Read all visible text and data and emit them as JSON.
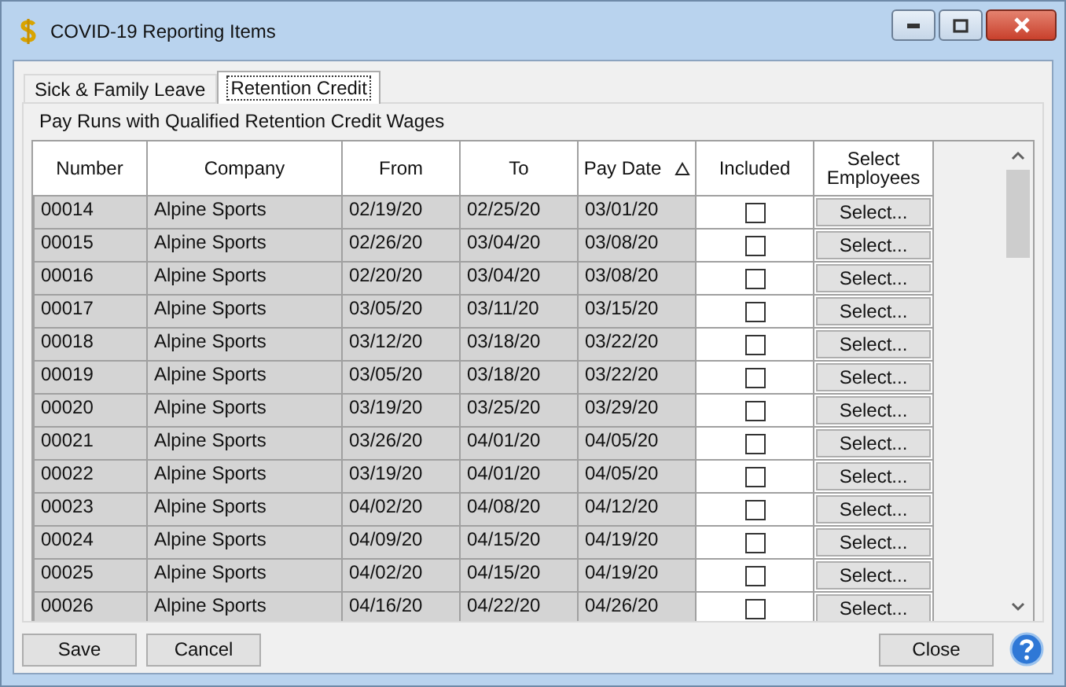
{
  "window": {
    "title": "COVID-19 Reporting Items"
  },
  "tabs": [
    {
      "label": "Sick & Family Leave",
      "selected": false
    },
    {
      "label": "Retention Credit",
      "selected": true
    }
  ],
  "panel": {
    "caption": "Pay Runs with Qualified Retention Credit Wages"
  },
  "table": {
    "columns": [
      {
        "label": "Number",
        "sorted": false
      },
      {
        "label": "Company",
        "sorted": false
      },
      {
        "label": "From",
        "sorted": false
      },
      {
        "label": "To",
        "sorted": false
      },
      {
        "label": "Pay Date",
        "sorted": true
      },
      {
        "label": "Included",
        "sorted": false
      },
      {
        "label": "Select Employees",
        "sorted": false
      }
    ],
    "rows": [
      {
        "number": "00014",
        "company": "Alpine Sports",
        "from": "02/19/20",
        "to": "02/25/20",
        "pay_date": "03/01/20",
        "included": false,
        "action": "Select..."
      },
      {
        "number": "00015",
        "company": "Alpine Sports",
        "from": "02/26/20",
        "to": "03/04/20",
        "pay_date": "03/08/20",
        "included": false,
        "action": "Select..."
      },
      {
        "number": "00016",
        "company": "Alpine Sports",
        "from": "02/20/20",
        "to": "03/04/20",
        "pay_date": "03/08/20",
        "included": false,
        "action": "Select..."
      },
      {
        "number": "00017",
        "company": "Alpine Sports",
        "from": "03/05/20",
        "to": "03/11/20",
        "pay_date": "03/15/20",
        "included": false,
        "action": "Select..."
      },
      {
        "number": "00018",
        "company": "Alpine Sports",
        "from": "03/12/20",
        "to": "03/18/20",
        "pay_date": "03/22/20",
        "included": false,
        "action": "Select..."
      },
      {
        "number": "00019",
        "company": "Alpine Sports",
        "from": "03/05/20",
        "to": "03/18/20",
        "pay_date": "03/22/20",
        "included": false,
        "action": "Select..."
      },
      {
        "number": "00020",
        "company": "Alpine Sports",
        "from": "03/19/20",
        "to": "03/25/20",
        "pay_date": "03/29/20",
        "included": false,
        "action": "Select..."
      },
      {
        "number": "00021",
        "company": "Alpine Sports",
        "from": "03/26/20",
        "to": "04/01/20",
        "pay_date": "04/05/20",
        "included": false,
        "action": "Select..."
      },
      {
        "number": "00022",
        "company": "Alpine Sports",
        "from": "03/19/20",
        "to": "04/01/20",
        "pay_date": "04/05/20",
        "included": false,
        "action": "Select..."
      },
      {
        "number": "00023",
        "company": "Alpine Sports",
        "from": "04/02/20",
        "to": "04/08/20",
        "pay_date": "04/12/20",
        "included": false,
        "action": "Select..."
      },
      {
        "number": "00024",
        "company": "Alpine Sports",
        "from": "04/09/20",
        "to": "04/15/20",
        "pay_date": "04/19/20",
        "included": false,
        "action": "Select..."
      },
      {
        "number": "00025",
        "company": "Alpine Sports",
        "from": "04/02/20",
        "to": "04/15/20",
        "pay_date": "04/19/20",
        "included": false,
        "action": "Select..."
      },
      {
        "number": "00026",
        "company": "Alpine Sports",
        "from": "04/16/20",
        "to": "04/22/20",
        "pay_date": "04/26/20",
        "included": false,
        "action": "Select..."
      }
    ]
  },
  "buttons": {
    "left": [
      "Save",
      "Cancel"
    ],
    "right": [
      "Close"
    ]
  }
}
